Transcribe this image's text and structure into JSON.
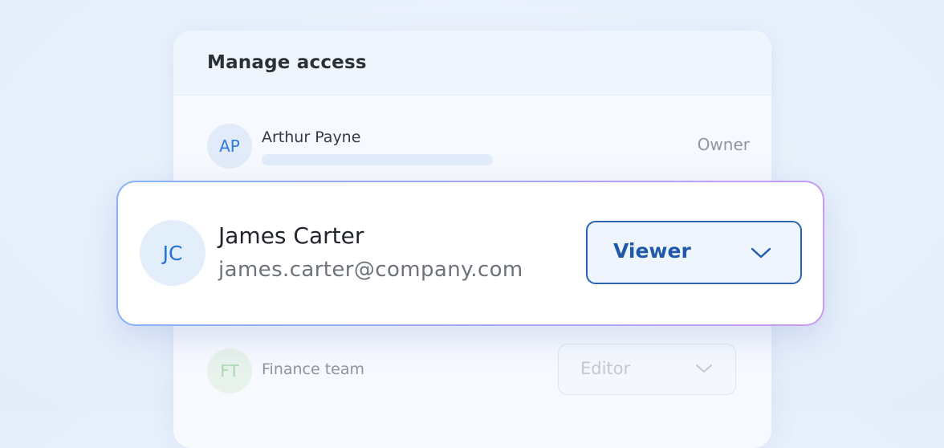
{
  "panel": {
    "title": "Manage access"
  },
  "members": [
    {
      "initials": "AP",
      "name": "Arthur Payne",
      "role": "Owner"
    },
    {
      "initials": "JC",
      "name": "James Carter",
      "email": "james.carter@company.com",
      "role": "Viewer"
    },
    {
      "initials": "FT",
      "name": "Finance team",
      "role": "Editor"
    }
  ],
  "icons": {
    "dropdown": "chevron-down-icon"
  },
  "colors": {
    "accent": "#2a63b2",
    "avatar_blue": "#2e7be0",
    "avatar_green": "#6fbb72",
    "card_gradient_start": "#86b3f7",
    "card_gradient_end": "#c79cf1"
  }
}
